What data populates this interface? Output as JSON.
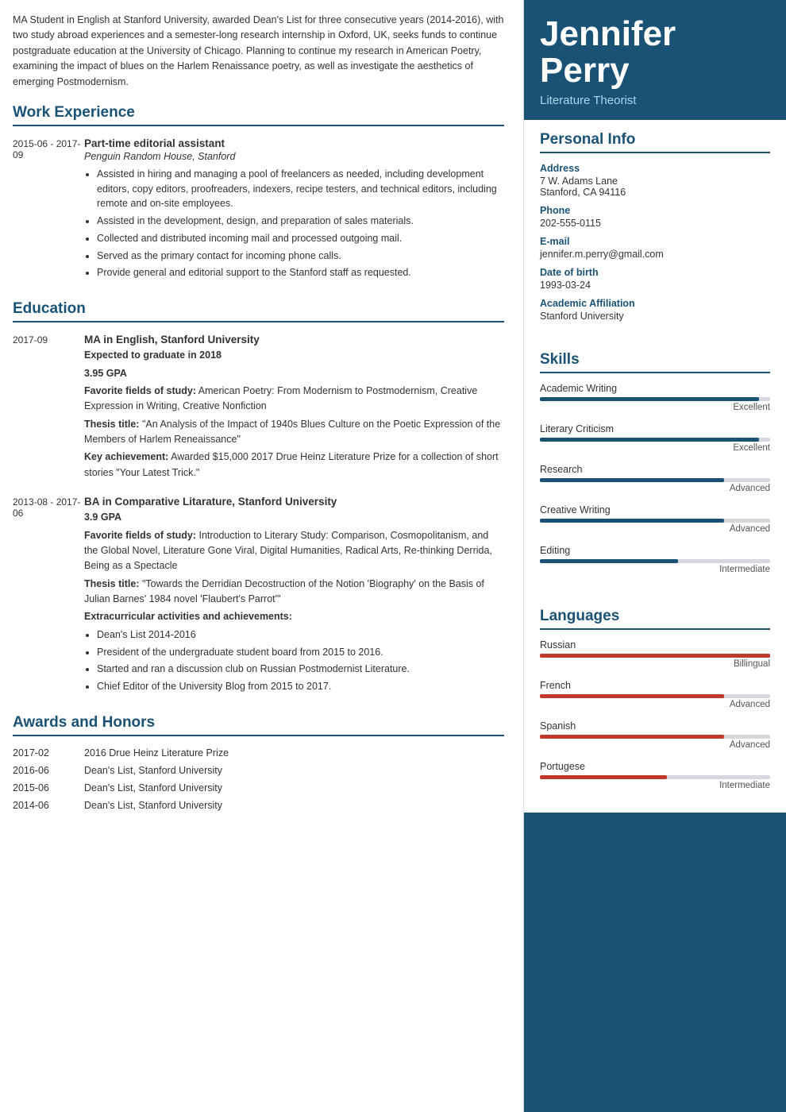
{
  "header": {
    "first_name": "Jennifer",
    "last_name": "Perry",
    "title": "Literature Theorist"
  },
  "intro": "MA Student in English at Stanford University, awarded Dean's List for three consecutive years (2014-2016), with two study abroad experiences and a semester-long research internship in Oxford, UK, seeks funds to continue postgraduate education at the University of Chicago. Planning to continue my research in American Poetry, examining the impact of blues on the Harlem Renaissance poetry, as well as investigate the aesthetics of emerging Postmodernism.",
  "sections": {
    "work_experience_title": "Work Experience",
    "education_title": "Education",
    "awards_title": "Awards and Honors"
  },
  "work_experience": [
    {
      "date": "2015-06 - 2017-09",
      "title": "Part-time editorial assistant",
      "company": "Penguin Random House, Stanford",
      "bullets": [
        "Assisted in hiring and managing a pool of freelancers as needed, including development editors, copy editors, proofreaders, indexers, recipe testers, and technical editors, including remote and on-site employees.",
        "Assisted in the development, design, and preparation of sales materials.",
        "Collected and distributed incoming mail and processed outgoing mail.",
        "Served as the primary contact for incoming phone calls.",
        "Provide general and editorial support to the Stanford staff as requested."
      ]
    }
  ],
  "education": [
    {
      "date": "2017-09",
      "degree": "MA in English, Stanford University",
      "lines": [
        {
          "bold": "Expected to graduate in 2018",
          "normal": ""
        },
        {
          "bold": "3.95 GPA",
          "normal": ""
        },
        {
          "bold": "Favorite fields of study:",
          "normal": " American Poetry: From Modernism to Postmodernism, Creative Expression in Writing, Creative Nonfiction"
        },
        {
          "bold": "Thesis title:",
          "normal": " \"An Analysis of the Impact of 1940s Blues Culture on the Poetic Expression of the Members of Harlem Reneaissance\""
        },
        {
          "bold": "Key achievement:",
          "normal": " Awarded $15,000 2017 Drue Heinz Literature Prize for a collection of short stories \"Your Latest Trick.\""
        }
      ],
      "bullets": []
    },
    {
      "date": "2013-08 - 2017-06",
      "degree": "BA in Comparative Litarature, Stanford University",
      "lines": [
        {
          "bold": "3.9 GPA",
          "normal": ""
        },
        {
          "bold": "Favorite fields of study:",
          "normal": " Introduction to Literary Study: Comparison, Cosmopolitanism, and the Global Novel, Literature Gone Viral, Digital Humanities, Radical Arts, Re-thinking Derrida, Being as a Spectacle"
        },
        {
          "bold": "Thesis title:",
          "normal": " \"Towards the Derridian Decostruction of the Notion 'Biography' on the Basis of Julian Barnes' 1984 novel 'Flaubert's Parrot'\""
        },
        {
          "bold": "Extracurricular activities and achievements:",
          "normal": ""
        }
      ],
      "bullets": [
        "Dean's List 2014-2016",
        "President of the undergraduate student board from 2015 to 2016.",
        "Started and ran a discussion club on Russian Postmodernist Literature.",
        "Chief Editor of the University Blog from 2015 to 2017."
      ]
    }
  ],
  "awards": [
    {
      "date": "2017-02",
      "text": "2016 Drue Heinz Literature Prize"
    },
    {
      "date": "2016-06",
      "text": "Dean's List, Stanford University"
    },
    {
      "date": "2015-06",
      "text": "Dean's List, Stanford University"
    },
    {
      "date": "2014-06",
      "text": "Dean's List, Stanford University"
    }
  ],
  "personal_info": {
    "title": "Personal Info",
    "address_label": "Address",
    "address_value": "7 W. Adams Lane\nStanford, CA 94116",
    "phone_label": "Phone",
    "phone_value": "202-555-0115",
    "email_label": "E-mail",
    "email_value": "jennifer.m.perry@gmail.com",
    "dob_label": "Date of birth",
    "dob_value": "1993-03-24",
    "affiliation_label": "Academic Affiliation",
    "affiliation_value": "Stanford University"
  },
  "skills": {
    "title": "Skills",
    "items": [
      {
        "name": "Academic Writing",
        "level_label": "Excellent",
        "percent": 95
      },
      {
        "name": "Literary Criticism",
        "level_label": "Excellent",
        "percent": 95
      },
      {
        "name": "Research",
        "level_label": "Advanced",
        "percent": 80
      },
      {
        "name": "Creative Writing",
        "level_label": "Advanced",
        "percent": 80
      },
      {
        "name": "Editing",
        "level_label": "Intermediate",
        "percent": 60
      }
    ]
  },
  "languages": {
    "title": "Languages",
    "items": [
      {
        "name": "Russian",
        "level_label": "Billingual",
        "percent": 100
      },
      {
        "name": "French",
        "level_label": "Advanced",
        "percent": 80
      },
      {
        "name": "Spanish",
        "level_label": "Advanced",
        "percent": 80
      },
      {
        "name": "Portugese",
        "level_label": "Intermediate",
        "percent": 55
      }
    ]
  }
}
